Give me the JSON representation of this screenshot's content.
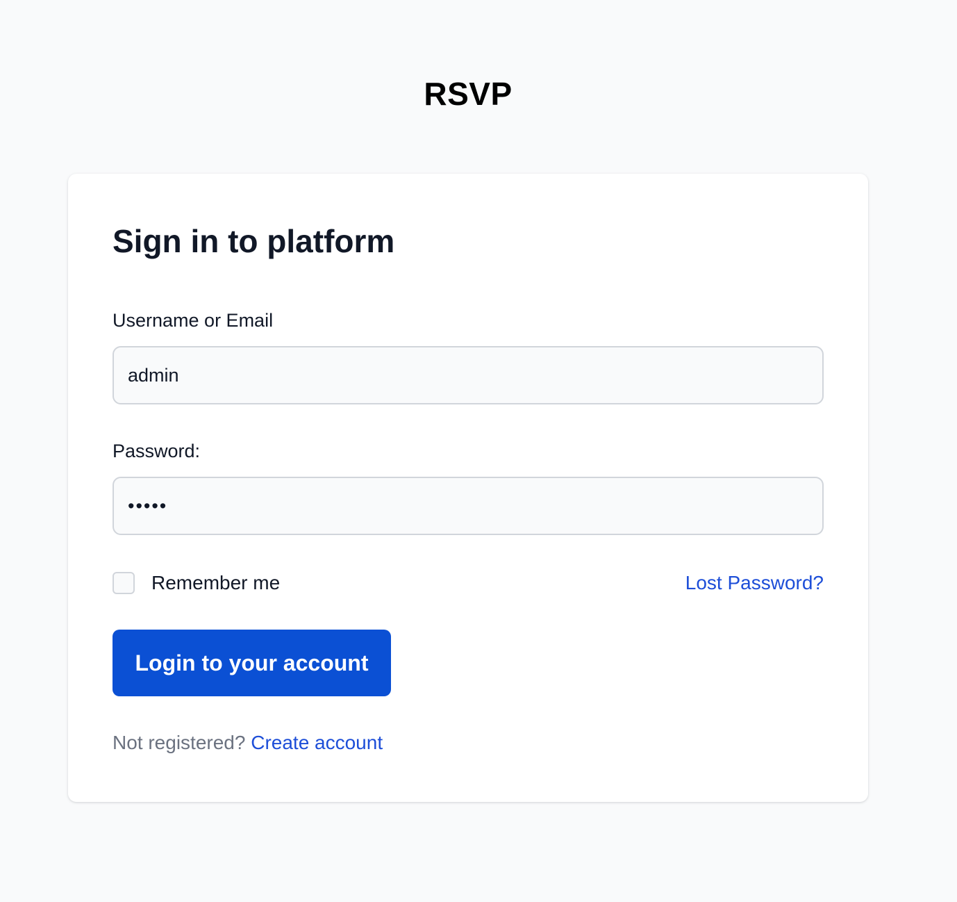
{
  "brand": {
    "title": "RSVP"
  },
  "form": {
    "heading": "Sign in to platform",
    "username_label": "Username or Email",
    "username_value": "admin",
    "password_label": "Password:",
    "password_value": "•••••",
    "remember_label": "Remember me",
    "remember_checked": false,
    "lost_password_label": "Lost Password?",
    "submit_label": "Login to your account",
    "register_prompt": "Not registered?",
    "register_link_label": "Create account"
  },
  "colors": {
    "background": "#f9fafb",
    "card": "#ffffff",
    "primary": "#0b50d4",
    "link": "#1d4ed8",
    "muted_text": "#6b7280",
    "text": "#111827"
  }
}
